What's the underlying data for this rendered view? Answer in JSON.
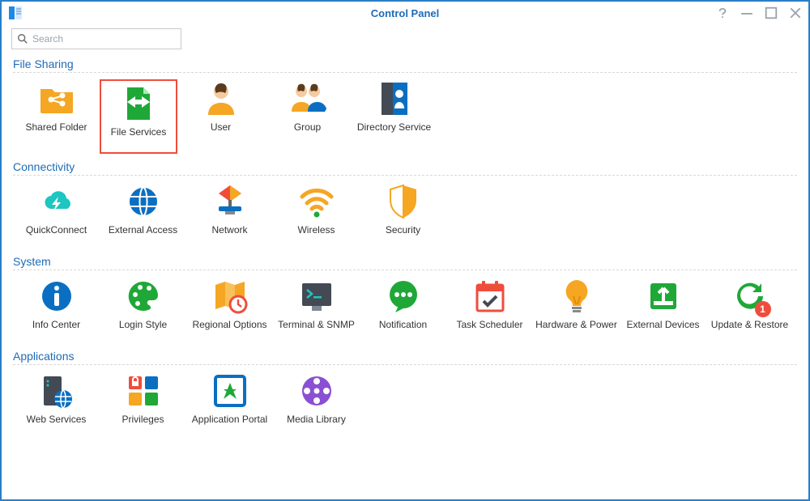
{
  "window_title": "Control Panel",
  "search": {
    "placeholder": "Search"
  },
  "sections": {
    "file_sharing": {
      "header": "File Sharing",
      "items": {
        "shared_folder": "Shared Folder",
        "file_services": "File Services",
        "user": "User",
        "group": "Group",
        "directory_service": "Directory Service"
      }
    },
    "connectivity": {
      "header": "Connectivity",
      "items": {
        "quickconnect": "QuickConnect",
        "external_access": "External Access",
        "network": "Network",
        "wireless": "Wireless",
        "security": "Security"
      }
    },
    "system": {
      "header": "System",
      "items": {
        "info_center": "Info Center",
        "login_style": "Login Style",
        "regional": "Regional Options",
        "terminal": "Terminal & SNMP",
        "notification": "Notification",
        "task_scheduler": "Task Scheduler",
        "hardware_power": "Hardware & Power",
        "external_devices": "External Devices",
        "update_restore": "Update & Restore"
      }
    },
    "applications": {
      "header": "Applications",
      "items": {
        "web_services": "Web Services",
        "privileges": "Privileges",
        "app_portal": "Application Portal",
        "media_library": "Media Library"
      }
    }
  },
  "selected_item": "file_services",
  "badges": {
    "update_restore": "1"
  }
}
